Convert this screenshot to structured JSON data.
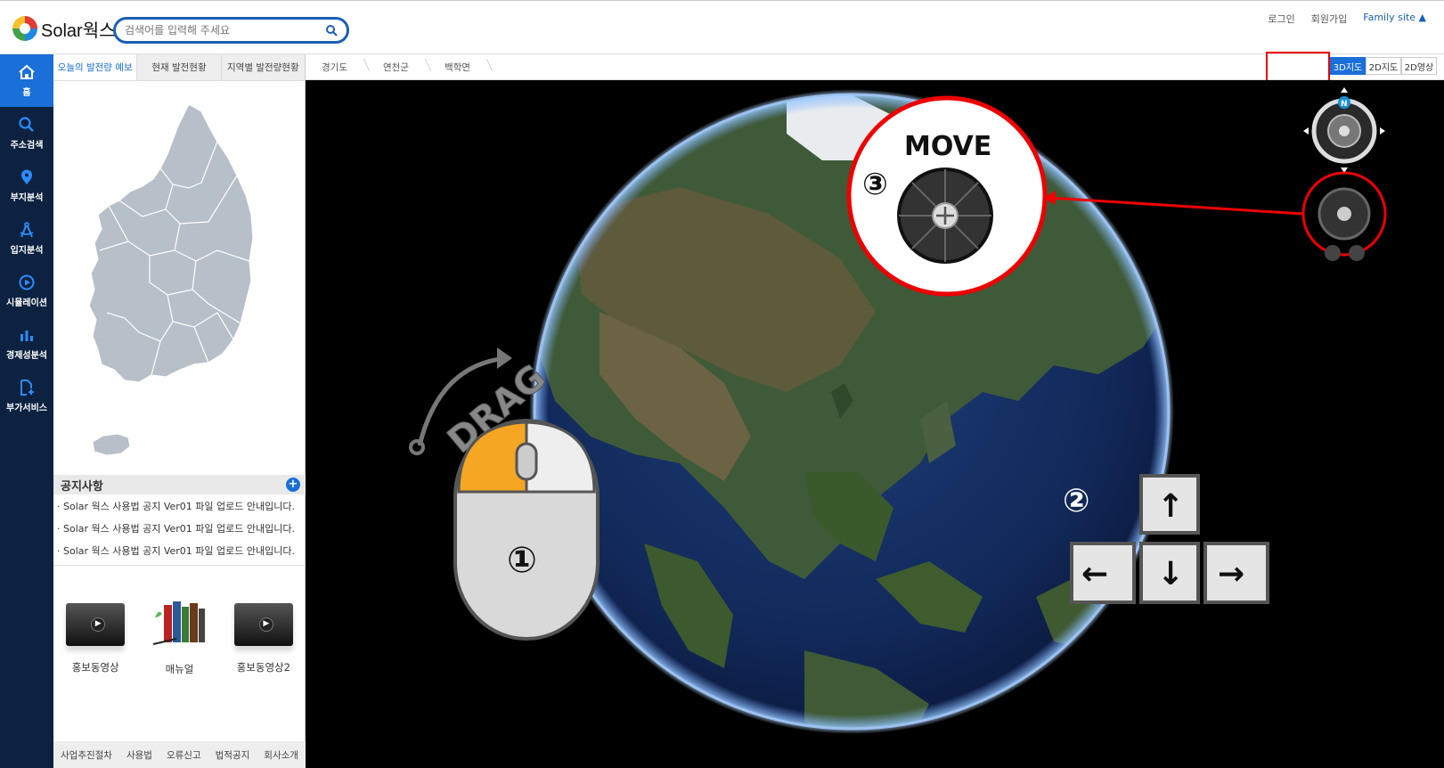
{
  "header": {
    "logo_text": "Solar웍스",
    "search_placeholder": "검색어를 입력해 주세요",
    "links": {
      "login": "로그인",
      "signup": "회원가입",
      "family_site": "Family site ▲"
    }
  },
  "leftnav": {
    "items": [
      {
        "label": "홈",
        "icon": "home-icon"
      },
      {
        "label": "주소검색",
        "icon": "search-icon"
      },
      {
        "label": "부지분석",
        "icon": "location-pin-icon"
      },
      {
        "label": "입지분석",
        "icon": "compass-icon"
      },
      {
        "label": "시뮬레이션",
        "icon": "play-icon"
      },
      {
        "label": "경제성분석",
        "icon": "bar-chart-icon"
      },
      {
        "label": "부가서비스",
        "icon": "add-document-icon"
      }
    ]
  },
  "panel": {
    "tabs": [
      "오늘의 발전량 예보",
      "현재 발전현황",
      "지역별 발전량현황"
    ],
    "notice": {
      "title": "공지사항",
      "items": [
        "· Solar 웍스 사용법 공지 Ver01 파일 업로드 안내입니다.",
        "· Solar 웍스 사용법 공지 Ver01 파일 업로드 안내입니다.",
        "· Solar 웍스 사용법 공지 Ver01 파일 업로드 안내입니다."
      ]
    },
    "media": [
      "홍보동영상",
      "매뉴얼",
      "홍보동영상2"
    ],
    "footer": [
      "사업추진절차",
      "사용법",
      "오류신고",
      "법적공지",
      "회사소개"
    ]
  },
  "breadcrumb": [
    "경기도",
    "연천군",
    "백학면"
  ],
  "view_buttons": [
    "3D지도",
    "2D지도",
    "2D영상"
  ],
  "overlay": {
    "drag_text": "DRAG",
    "move_text": "MOVE",
    "num1": "①",
    "num2": "②",
    "num3": "③",
    "compass_n": "N",
    "arrow_keys": {
      "up": "↑",
      "down": "↓",
      "left": "←",
      "right": "→"
    }
  },
  "colors": {
    "accent": "#1a6fd8",
    "nav_bg": "#0d2240",
    "highlight": "#e00000",
    "mouse_button": "#f5a623"
  }
}
